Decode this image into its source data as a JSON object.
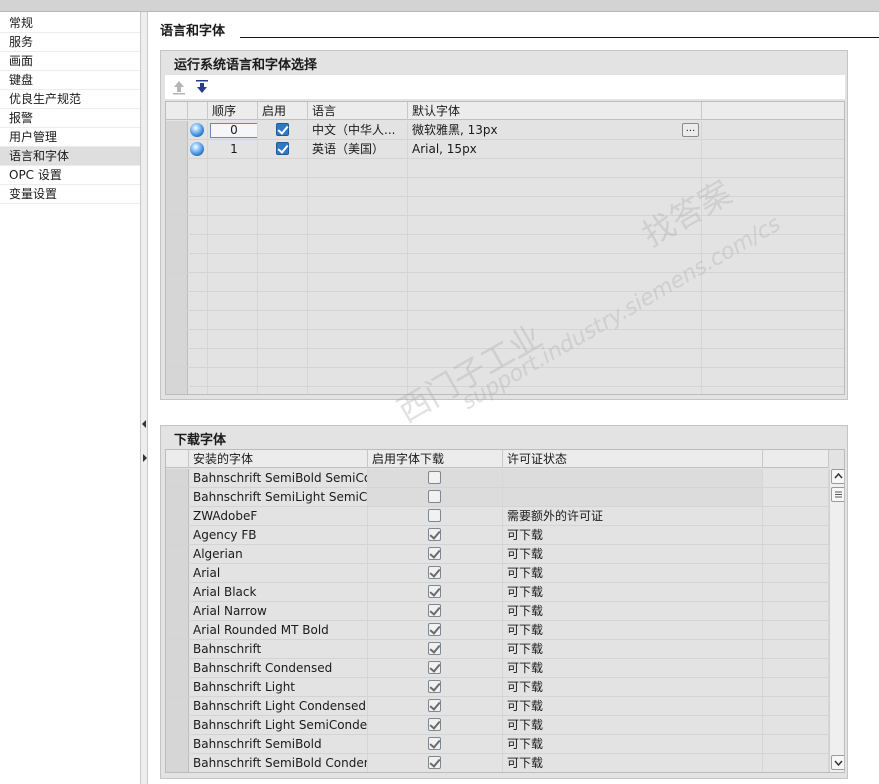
{
  "nav": {
    "items": [
      "常规",
      "服务",
      "画面",
      "键盘",
      "优良生产规范",
      "报警",
      "用户管理",
      "语言和字体",
      "OPC 设置",
      "变量设置"
    ],
    "selected_index": 7
  },
  "section": {
    "title": "语言和字体"
  },
  "runtime_group": {
    "title": "运行系统语言和字体选择",
    "toolbar": {
      "move_up_icon": "arrow-up-icon",
      "move_down_icon": "arrow-down-icon"
    },
    "columns": [
      "顺序",
      "启用",
      "语言",
      "默认字体"
    ],
    "rows": [
      {
        "order": "0",
        "enabled": true,
        "language": "中文（中华人...",
        "font": "微软雅黑, 13px"
      },
      {
        "order": "1",
        "enabled": true,
        "language": "英语（美国）",
        "font": "Arial, 15px"
      }
    ],
    "ellipsis_label": "..."
  },
  "download_group": {
    "title": "下载字体",
    "columns": [
      "安装的字体",
      "启用字体下载",
      "许可证状态"
    ],
    "rows": [
      {
        "font": "Bahnschrift SemiBold SemiCon...",
        "enabled": false,
        "status": ""
      },
      {
        "font": "Bahnschrift SemiLight SemiCo...",
        "enabled": false,
        "status": ""
      },
      {
        "font": "ZWAdobeF",
        "enabled": false,
        "status": "需要额外的许可证"
      },
      {
        "font": "Agency FB",
        "enabled": true,
        "status": "可下载"
      },
      {
        "font": "Algerian",
        "enabled": true,
        "status": "可下载"
      },
      {
        "font": "Arial",
        "enabled": true,
        "status": "可下载"
      },
      {
        "font": "Arial Black",
        "enabled": true,
        "status": "可下载"
      },
      {
        "font": "Arial Narrow",
        "enabled": true,
        "status": "可下载"
      },
      {
        "font": "Arial Rounded MT Bold",
        "enabled": true,
        "status": "可下载"
      },
      {
        "font": "Bahnschrift",
        "enabled": true,
        "status": "可下载"
      },
      {
        "font": "Bahnschrift Condensed",
        "enabled": true,
        "status": "可下载"
      },
      {
        "font": "Bahnschrift Light",
        "enabled": true,
        "status": "可下载"
      },
      {
        "font": "Bahnschrift Light Condensed",
        "enabled": true,
        "status": "可下载"
      },
      {
        "font": "Bahnschrift Light SemiConden...",
        "enabled": true,
        "status": "可下载"
      },
      {
        "font": "Bahnschrift SemiBold",
        "enabled": true,
        "status": "可下载"
      },
      {
        "font": "Bahnschrift SemiBold Condens...",
        "enabled": true,
        "status": "可下载"
      }
    ]
  },
  "watermark": {
    "line1": "西门子工业",
    "line2": "support.industry.siemens.com/cs",
    "line3": "找答案"
  }
}
